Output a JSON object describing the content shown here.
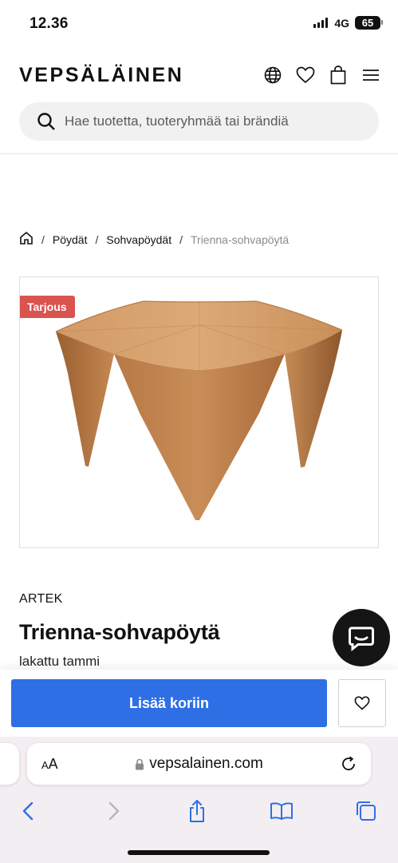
{
  "status_bar": {
    "time": "12.36",
    "network": "4G",
    "battery": "65"
  },
  "header": {
    "logo": "VEPSÄLÄINEN",
    "search_placeholder": "Hae tuotetta, tuoteryhmää tai brändiä"
  },
  "breadcrumb": {
    "items": [
      "Pöydät",
      "Sohvapöydät"
    ],
    "current": "Trienna-sohvapöytä"
  },
  "product": {
    "badge": "Tarjous",
    "brand": "ARTEK",
    "title": "Trienna-sohvapöytä",
    "variant": "lakattu tammi"
  },
  "actions": {
    "add_to_cart": "Lisää koriin"
  },
  "browser": {
    "text_size_label": "AA",
    "url": "vepsalainen.com"
  },
  "colors": {
    "accent": "#2f6fe5",
    "badge": "#d9534f",
    "wood": "#c68a55"
  }
}
